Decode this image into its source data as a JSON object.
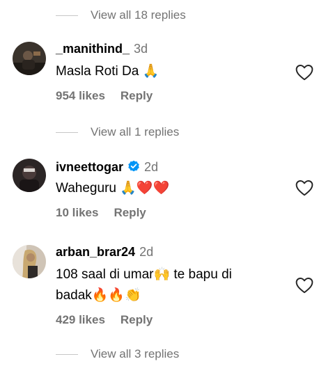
{
  "threads": [
    {
      "view_replies": "View all 18 replies"
    },
    {
      "username": "_manithind_",
      "verified": false,
      "time": "3d",
      "text": "Masla Roti Da 🙏",
      "likes": "954 likes",
      "reply_label": "Reply",
      "view_replies": "View all 1 replies"
    },
    {
      "username": "ivneettogar",
      "verified": true,
      "time": "2d",
      "text": "Waheguru 🙏❤️❤️",
      "likes": "10 likes",
      "reply_label": "Reply"
    },
    {
      "username": "arban_brar24",
      "verified": false,
      "time": "2d",
      "text_line1": "108 saal di umar🙌 te bapu di",
      "text_line2": "badak🔥🔥👏",
      "likes": "429 likes",
      "reply_label": "Reply",
      "view_replies": "View all 3 replies"
    }
  ],
  "colors": {
    "secondary_text": "#737373",
    "divider": "#c7c7c7",
    "verified_blue": "#0095f6"
  },
  "icons": {
    "like": "heart-outline-icon",
    "verified": "verified-badge-icon"
  }
}
